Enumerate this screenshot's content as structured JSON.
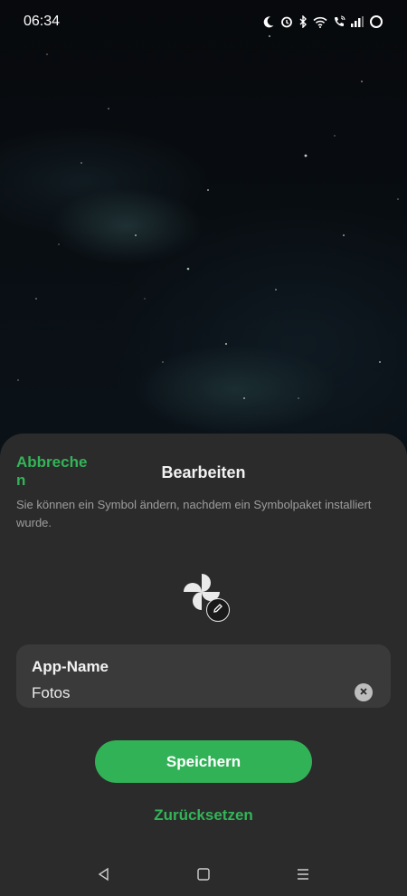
{
  "status_bar": {
    "time": "06:34",
    "icons": [
      "moon-icon",
      "alarm-icon",
      "bluetooth-icon",
      "wifi-icon",
      "wifi-calling-icon",
      "signal-icon",
      "battery-ring-icon"
    ]
  },
  "sheet": {
    "cancel_label": "Abbrechen",
    "title": "Bearbeiten",
    "hint": "Sie können ein Symbol ändern, nachdem ein Symbolpaket installiert wurde.",
    "app_icon": "pinwheel-icon",
    "edit_icon": "pencil-icon",
    "name_field": {
      "label": "App-Name",
      "value": "Fotos"
    },
    "save_label": "Speichern",
    "reset_label": "Zurücksetzen"
  },
  "nav_bar": {
    "icons": [
      "back-icon",
      "home-icon",
      "menu-icon"
    ]
  },
  "colors": {
    "accent": "#33b458",
    "sheet_bg": "#2b2b2b",
    "field_bg": "#3a3a3a"
  }
}
